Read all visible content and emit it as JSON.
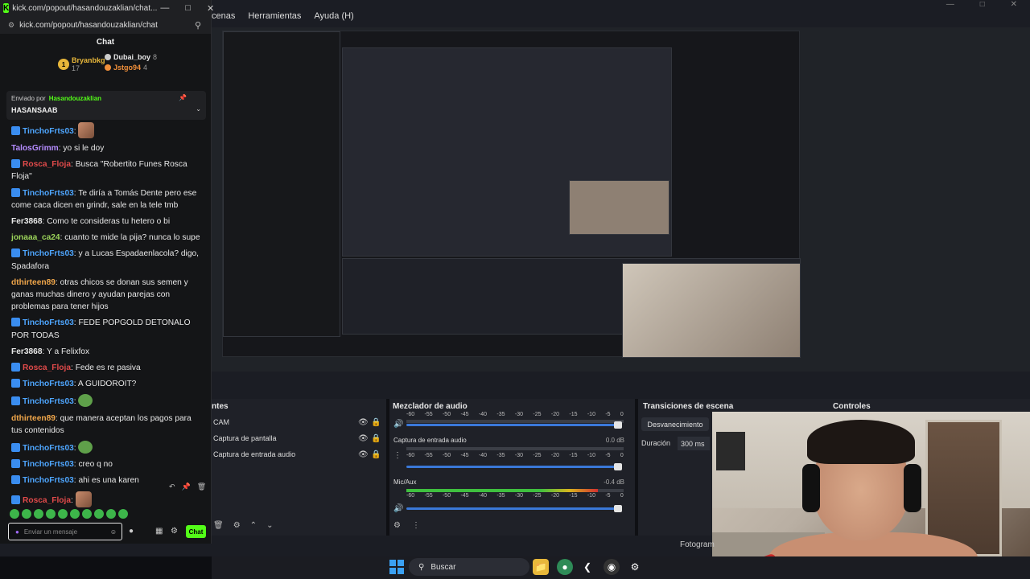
{
  "obs": {
    "menu": [
      "cenas",
      "Herramientas",
      "Ayuda (H)"
    ],
    "docks": {
      "sources_title": "ntes",
      "mixer_title": "Mezclador de audio",
      "transitions_title": "Transiciones de escena",
      "controls_title": "Controles"
    },
    "sources": [
      "CAM",
      "Captura de pantalla",
      "Captura de entrada audio"
    ],
    "mixer": {
      "scale": [
        "-60",
        "-55",
        "-50",
        "-45",
        "-40",
        "-35",
        "-30",
        "-25",
        "-20",
        "-15",
        "-10",
        "-5",
        "0"
      ],
      "channels": [
        {
          "name": "",
          "db": "",
          "level": 0.0
        },
        {
          "name": "Captura de entrada audio",
          "db": "0.0 dB",
          "level": 0.0
        },
        {
          "name": "Mic/Aux",
          "db": "-0.4 dB",
          "level": 0.88
        }
      ]
    },
    "transitions": {
      "button": "Desvanecimiento",
      "duration_label": "Duración",
      "duration_value": "300 ms"
    },
    "status": "Fotogram"
  },
  "taskbar": {
    "search": "Buscar"
  },
  "chat": {
    "window_title": "kick.com/popout/hasandouzaklian/chat...",
    "url": "kick.com/popout/hasandouzaklian/chat",
    "header": "Chat",
    "gifters": [
      {
        "name": "Bryanbkg",
        "count": "17",
        "color": "#e8b73a"
      },
      {
        "name": "Dubai_boy",
        "count": "8",
        "color": "#e8e8e8"
      },
      {
        "name": "Jstgo94",
        "count": "4",
        "color": "#f08f3a"
      }
    ],
    "pinned": {
      "by_label": "Enviado por",
      "by_user": "Hasandouzaklian",
      "text": "HASANSAAB"
    },
    "messages": [
      {
        "user": "TinchoFrts03",
        "color": "#4ea6ff",
        "badge": true,
        "text": "",
        "emote": "face"
      },
      {
        "user": "TalosGrimm",
        "color": "#b58cff",
        "badge": false,
        "text": "yo si le doy",
        "emote": ""
      },
      {
        "user": "Rosca_Floja",
        "color": "#e04a4a",
        "badge": true,
        "text": "Busca \"Robertito Funes Rosca Floja\"",
        "emote": ""
      },
      {
        "user": "TinchoFrts03",
        "color": "#4ea6ff",
        "badge": true,
        "text": "Te diría a Tomás Dente pero ese come caca dicen en grindr, sale en la tele tmb",
        "emote": ""
      },
      {
        "user": "Fer3868",
        "color": "#e8e8e8",
        "badge": false,
        "text": "Como te consideras tu hetero o bi",
        "emote": ""
      },
      {
        "user": "jonaaa_ca24",
        "color": "#9bd35a",
        "badge": false,
        "text": "cuanto te mide la pija? nunca lo supe",
        "emote": ""
      },
      {
        "user": "TinchoFrts03",
        "color": "#4ea6ff",
        "badge": true,
        "text": "y a Lucas Espadaenlacola? digo, Spadafora",
        "emote": ""
      },
      {
        "user": "dthirteen89",
        "color": "#f0a64a",
        "badge": false,
        "text": "otras chicos se donan sus semen y ganas muchas dinero y ayudan parejas con problemas para tener hijos",
        "emote": ""
      },
      {
        "user": "TinchoFrts03",
        "color": "#4ea6ff",
        "badge": true,
        "text": "FEDE POPGOLD DETONALO POR TODAS",
        "emote": ""
      },
      {
        "user": "Fer3868",
        "color": "#e8e8e8",
        "badge": false,
        "text": "Y a Felixfox",
        "emote": ""
      },
      {
        "user": "Rosca_Floja",
        "color": "#e04a4a",
        "badge": true,
        "text": "Fede es re pasiva",
        "emote": ""
      },
      {
        "user": "TinchoFrts03",
        "color": "#4ea6ff",
        "badge": true,
        "text": "A GUIDOROIT?",
        "emote": ""
      },
      {
        "user": "TinchoFrts03",
        "color": "#4ea6ff",
        "badge": true,
        "text": "",
        "emote": "pepe"
      },
      {
        "user": "dthirteen89",
        "color": "#f0a64a",
        "badge": false,
        "text": "que manera aceptan los pagos para tus contenidos",
        "emote": ""
      },
      {
        "user": "TinchoFrts03",
        "color": "#4ea6ff",
        "badge": true,
        "text": "",
        "emote": "pepe"
      },
      {
        "user": "TinchoFrts03",
        "color": "#4ea6ff",
        "badge": true,
        "text": "creo q no",
        "emote": ""
      },
      {
        "user": "TinchoFrts03",
        "color": "#4ea6ff",
        "badge": true,
        "text": "ahi es una karen",
        "emote": ""
      },
      {
        "user": "Rosca_Floja",
        "color": "#e04a4a",
        "badge": true,
        "text": "",
        "emote": "face"
      }
    ],
    "input_placeholder": "Enviar un mensaje",
    "send_label": "Chat"
  }
}
